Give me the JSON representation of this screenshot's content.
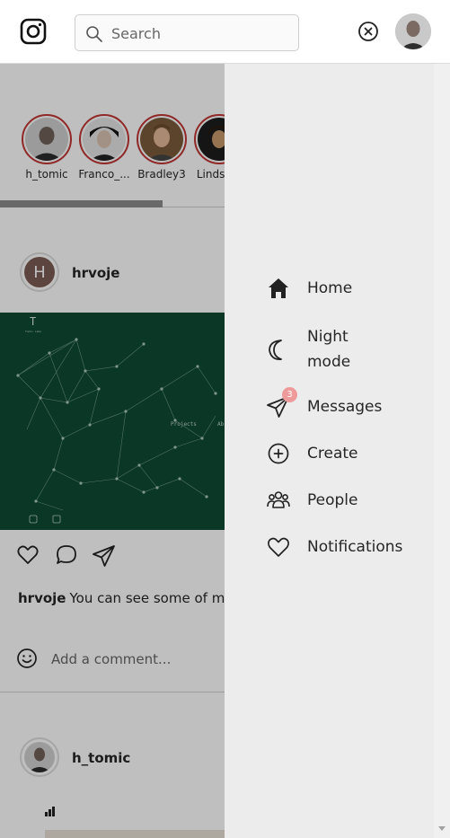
{
  "header": {
    "search_placeholder": "Search"
  },
  "stories": [
    {
      "username": "h_tomic"
    },
    {
      "username": "Franco_..."
    },
    {
      "username": "Bradley3"
    },
    {
      "username": "Lindse..."
    }
  ],
  "post": {
    "avatar_initial": "H",
    "username": "hrvoje",
    "image_text": {
      "projects": "Projects",
      "about": "Ab"
    },
    "caption_user": "hrvoje",
    "caption_text": "You can see some of my",
    "comment_placeholder": "Add a comment..."
  },
  "post2": {
    "username": "h_tomic"
  },
  "drawer": {
    "items": [
      {
        "label": "Home",
        "icon": "home-icon"
      },
      {
        "label": "Night mode",
        "icon": "moon-icon"
      },
      {
        "label": "Messages",
        "icon": "send-icon",
        "badge": "3"
      },
      {
        "label": "Create",
        "icon": "plus-circle-icon"
      },
      {
        "label": "People",
        "icon": "people-icon"
      },
      {
        "label": "Notifications",
        "icon": "heart-icon"
      }
    ]
  },
  "colors": {
    "story_ring": "#c13636",
    "badge": "#ef9a9a",
    "drawer_bg": "#ececec",
    "post_image_bg": "#0f4a33"
  }
}
